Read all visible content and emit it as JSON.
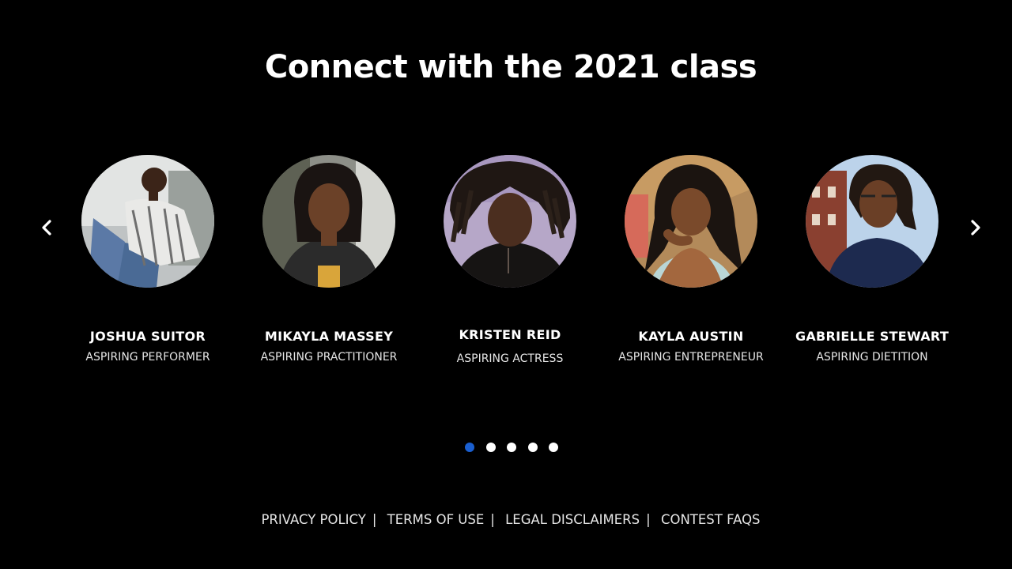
{
  "heading": "Connect with the 2021 class",
  "carousel": {
    "prev_icon": "chevron-left-icon",
    "next_icon": "chevron-right-icon",
    "members": [
      {
        "name": "JOSHUA SUITOR",
        "role": "ASPIRING PERFORMER"
      },
      {
        "name": "MIKAYLA MASSEY",
        "role": "ASPIRING PRACTITIONER"
      },
      {
        "name": "KRISTEN REID",
        "role": "ASPIRING ACTRESS"
      },
      {
        "name": "KAYLA AUSTIN",
        "role": "ASPIRING ENTREPRENEUR"
      },
      {
        "name": "GABRIELLE STEWART",
        "role": "ASPIRING DIETITION"
      }
    ],
    "pagination": {
      "count": 5,
      "active_index": 0,
      "active_color": "#1a5fd0"
    }
  },
  "footer": {
    "links": [
      "PRIVACY POLICY",
      "TERMS OF USE",
      "LEGAL DISCLAIMERS",
      "CONTEST FAQS"
    ],
    "separator": "|"
  }
}
